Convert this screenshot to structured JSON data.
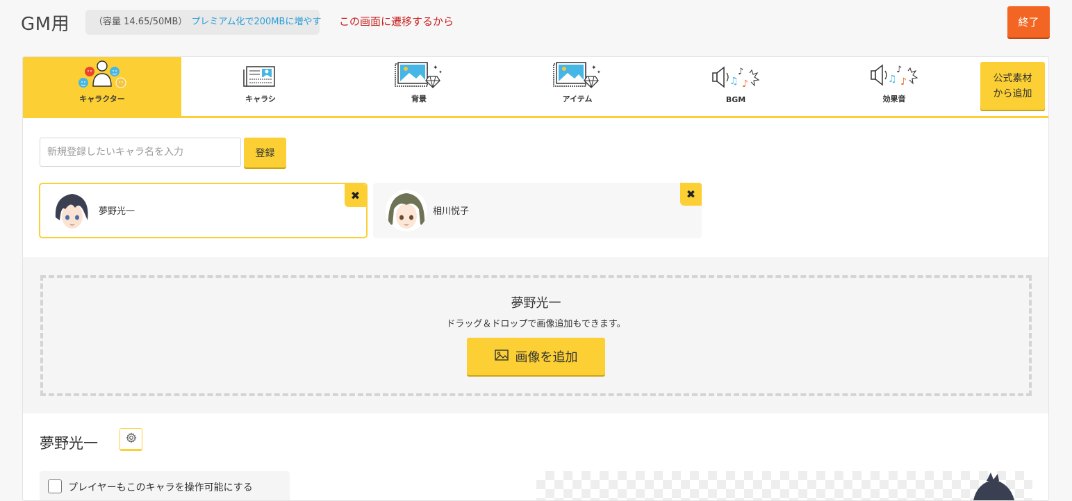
{
  "header": {
    "title": "GM用",
    "capacity_text": "（容量 14.65/50MB）",
    "premium_link": "プレミアム化で200MBに増やす",
    "note": "この画面に遷移するから",
    "exit_label": "終了"
  },
  "tabs": [
    {
      "label": "キャラクター",
      "icon": "character-icon",
      "active": true
    },
    {
      "label": "キャラシ",
      "icon": "character-sheet-icon",
      "active": false
    },
    {
      "label": "背景",
      "icon": "background-image-icon",
      "active": false
    },
    {
      "label": "アイテム",
      "icon": "item-image-icon",
      "active": false
    },
    {
      "label": "BGM",
      "icon": "bgm-speaker-icon",
      "active": false
    },
    {
      "label": "効果音",
      "icon": "sound-effect-icon",
      "active": false
    }
  ],
  "official_button": {
    "line1": "公式素材",
    "line2": "から追加"
  },
  "register": {
    "placeholder": "新規登録したいキャラ名を入力",
    "value": "",
    "button_label": "登録"
  },
  "characters": [
    {
      "name": "夢野光一",
      "selected": true,
      "delete_label": "✖"
    },
    {
      "name": "相川悦子",
      "selected": false,
      "delete_label": "✖"
    }
  ],
  "dropzone": {
    "title": "夢野光一",
    "hint": "ドラッグ＆ドロップで画像追加もできます。",
    "add_button": "画像を追加"
  },
  "detail": {
    "title": "夢野光一",
    "option_label": "プレイヤーもこのキャラを操作可能にする",
    "option_checked": false
  },
  "colors": {
    "accent": "#fcd034",
    "exit": "#f26522",
    "note": "#c81d1d",
    "link": "#2a9fd8"
  }
}
